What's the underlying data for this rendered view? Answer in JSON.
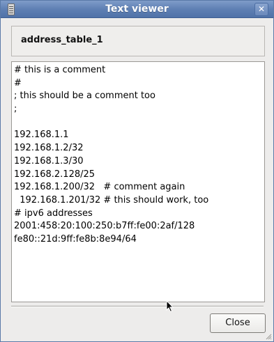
{
  "window": {
    "title": "Text viewer",
    "close_glyph": "✕",
    "icon": "app-icon"
  },
  "header": {
    "label": "address_table_1"
  },
  "content": {
    "lines": [
      "# this is a comment",
      "#",
      "; this should be a comment too",
      ";",
      "",
      "192.168.1.1",
      "192.168.1.2/32",
      "192.168.1.3/30",
      "192.168.2.128/25",
      "192.168.1.200/32   # comment again",
      "  192.168.1.201/32 # this should work, too",
      "# ipv6 addresses",
      "2001:458:20:100:250:b7ff:fe00:2af/128",
      "fe80::21d:9ff:fe8b:8e94/64"
    ]
  },
  "footer": {
    "close_label": "Close"
  },
  "colors": {
    "titlebar": "#5f80b4",
    "window_bg": "#edeceb"
  }
}
